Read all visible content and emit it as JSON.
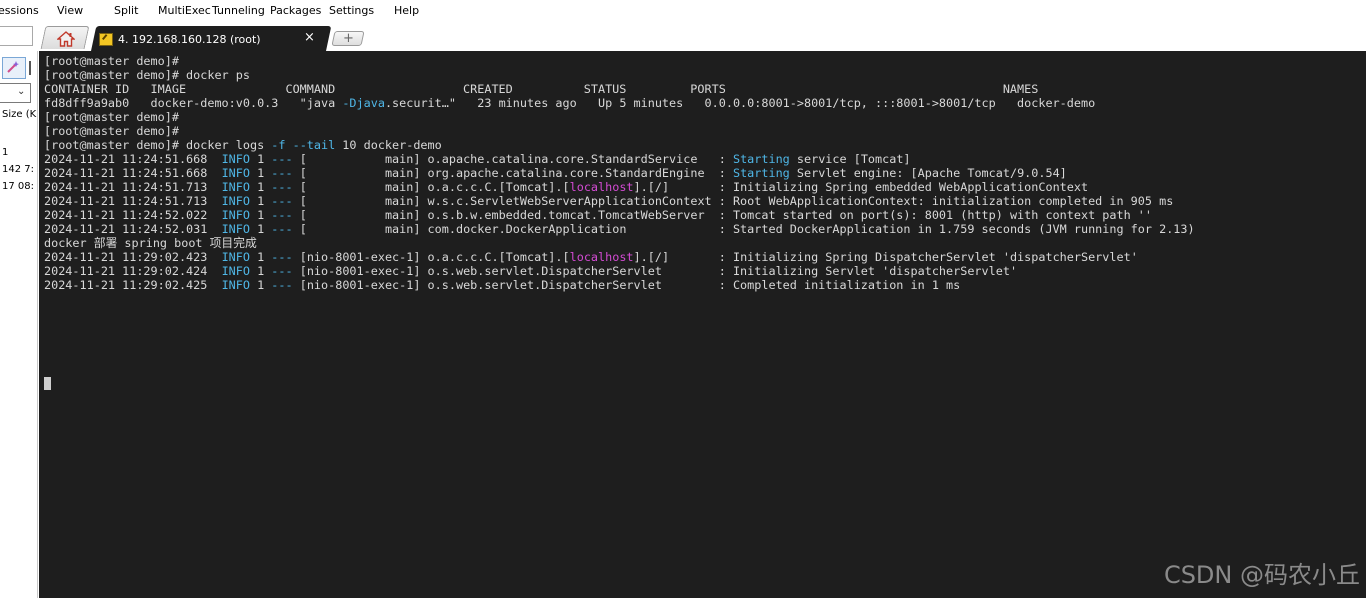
{
  "menu": {
    "items": [
      "essions",
      "View",
      "Split",
      "MultiExec",
      "Tunneling",
      "Packages",
      "Settings",
      "Help"
    ]
  },
  "tabs": {
    "session_label": "4. 192.168.160.128 (root)",
    "close_glyph": "×",
    "new_tab_glyph": "+"
  },
  "left_panel": {
    "header": "Size (K",
    "row1": "1",
    "row2": "142 7:",
    "row3": "17 08:"
  },
  "terminal": {
    "lines": [
      {
        "segments": [
          {
            "t": "[root@master demo]#"
          }
        ]
      },
      {
        "segments": [
          {
            "t": "[root@master demo]# docker ps"
          }
        ]
      },
      {
        "segments": [
          {
            "t": "CONTAINER ID   IMAGE              COMMAND                  CREATED          STATUS         PORTS                                       NAMES"
          }
        ]
      },
      {
        "segments": [
          {
            "t": "fd8dff9a9ab0   docker-demo:v0.0.3   \"java "
          },
          {
            "t": "-Djava",
            "c": "cyan"
          },
          {
            "t": ".securit…\"   23 minutes ago   Up 5 minutes   0.0.0.0:8001->8001/tcp, :::8001->8001/tcp   docker-demo"
          }
        ]
      },
      {
        "segments": [
          {
            "t": "[root@master demo]#"
          }
        ]
      },
      {
        "segments": [
          {
            "t": "[root@master demo]#"
          }
        ]
      },
      {
        "segments": [
          {
            "t": "[root@master demo]# docker logs "
          },
          {
            "t": "-f --tail",
            "c": "cyan"
          },
          {
            "t": " 10 docker-demo"
          }
        ]
      },
      {
        "segments": [
          {
            "t": "2024-11-21 11:24:51.668  "
          },
          {
            "t": "INFO",
            "c": "cyan"
          },
          {
            "t": " 1 "
          },
          {
            "t": "---",
            "c": "cyan"
          },
          {
            "t": " [           main] o.apache.catalina.core.StandardService   : "
          },
          {
            "t": "Starting",
            "c": "cyan"
          },
          {
            "t": " service [Tomcat]"
          }
        ]
      },
      {
        "segments": [
          {
            "t": "2024-11-21 11:24:51.668  "
          },
          {
            "t": "INFO",
            "c": "cyan"
          },
          {
            "t": " 1 "
          },
          {
            "t": "---",
            "c": "cyan"
          },
          {
            "t": " [           main] org.apache.catalina.core.StandardEngine  : "
          },
          {
            "t": "Starting",
            "c": "cyan"
          },
          {
            "t": " Servlet engine: [Apache Tomcat/9.0.54]"
          }
        ]
      },
      {
        "segments": [
          {
            "t": "2024-11-21 11:24:51.713  "
          },
          {
            "t": "INFO",
            "c": "cyan"
          },
          {
            "t": " 1 "
          },
          {
            "t": "---",
            "c": "cyan"
          },
          {
            "t": " [           main] o.a.c.c.C.[Tomcat].["
          },
          {
            "t": "localhost",
            "c": "magenta"
          },
          {
            "t": "].[/]       : Initializing Spring embedded WebApplicationContext"
          }
        ]
      },
      {
        "segments": [
          {
            "t": "2024-11-21 11:24:51.713  "
          },
          {
            "t": "INFO",
            "c": "cyan"
          },
          {
            "t": " 1 "
          },
          {
            "t": "---",
            "c": "cyan"
          },
          {
            "t": " [           main] w.s.c.ServletWebServerApplicationContext : Root WebApplicationContext: initialization completed in 905 ms"
          }
        ]
      },
      {
        "segments": [
          {
            "t": "2024-11-21 11:24:52.022  "
          },
          {
            "t": "INFO",
            "c": "cyan"
          },
          {
            "t": " 1 "
          },
          {
            "t": "---",
            "c": "cyan"
          },
          {
            "t": " [           main] o.s.b.w.embedded.tomcat.TomcatWebServer  : Tomcat started on port(s): 8001 (http) with context path ''"
          }
        ]
      },
      {
        "segments": [
          {
            "t": "2024-11-21 11:24:52.031  "
          },
          {
            "t": "INFO",
            "c": "cyan"
          },
          {
            "t": " 1 "
          },
          {
            "t": "---",
            "c": "cyan"
          },
          {
            "t": " [           main] com.docker.DockerApplication             : Started DockerApplication in 1.759 seconds (JVM running for 2.13)"
          }
        ]
      },
      {
        "segments": [
          {
            "t": "docker 部署 spring boot 项目完成"
          }
        ]
      },
      {
        "segments": [
          {
            "t": "2024-11-21 11:29:02.423  "
          },
          {
            "t": "INFO",
            "c": "cyan"
          },
          {
            "t": " 1 "
          },
          {
            "t": "---",
            "c": "cyan"
          },
          {
            "t": " [nio-8001-exec-1] o.a.c.c.C.[Tomcat].["
          },
          {
            "t": "localhost",
            "c": "magenta"
          },
          {
            "t": "].[/]       : Initializing Spring DispatcherServlet 'dispatcherServlet'"
          }
        ]
      },
      {
        "segments": [
          {
            "t": "2024-11-21 11:29:02.424  "
          },
          {
            "t": "INFO",
            "c": "cyan"
          },
          {
            "t": " 1 "
          },
          {
            "t": "---",
            "c": "cyan"
          },
          {
            "t": " [nio-8001-exec-1] o.s.web.servlet.DispatcherServlet        : Initializing Servlet 'dispatcherServlet'"
          }
        ]
      },
      {
        "segments": [
          {
            "t": "2024-11-21 11:29:02.425  "
          },
          {
            "t": "INFO",
            "c": "cyan"
          },
          {
            "t": " 1 "
          },
          {
            "t": "---",
            "c": "cyan"
          },
          {
            "t": " [nio-8001-exec-1] o.s.web.servlet.DispatcherServlet        : Completed initialization in 1 ms"
          }
        ]
      }
    ],
    "watermark": "CSDN @码农小丘"
  },
  "colors": {
    "terminal_bg": "#1e1e1e",
    "terminal_fg": "#d8d8d8",
    "cyan": "#4fb6e6",
    "magenta": "#d34bd3"
  },
  "icons": {
    "home_tab": "home-icon",
    "session_tab": "wrench-icon",
    "tool": "magic-wand-icon"
  }
}
